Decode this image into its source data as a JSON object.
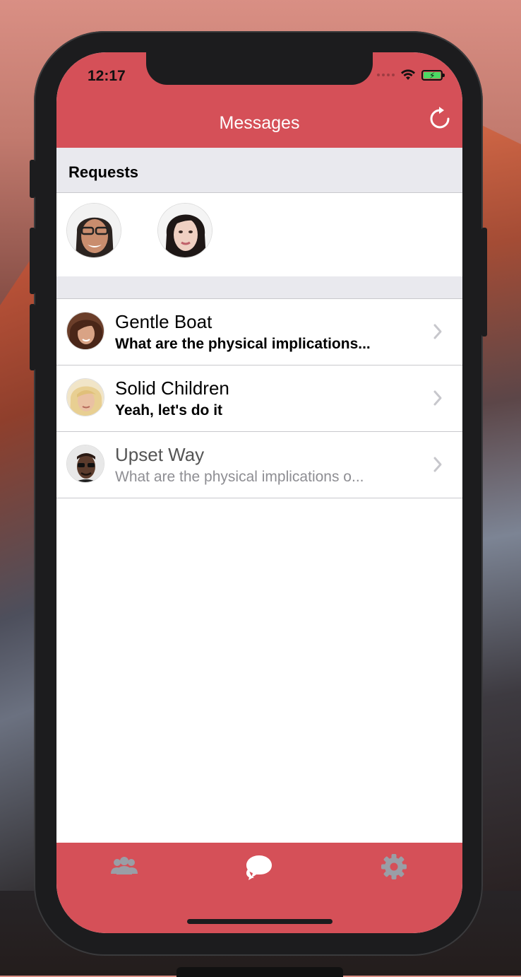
{
  "status_bar": {
    "time": "12:17"
  },
  "nav": {
    "title": "Messages",
    "refresh_icon": "refresh-icon"
  },
  "requests_section": {
    "label": "Requests",
    "avatars": [
      {
        "name": "request-avatar-1"
      },
      {
        "name": "request-avatar-2"
      }
    ]
  },
  "chats": [
    {
      "name": "Gentle Boat",
      "preview": "What are the physical implications...",
      "state": "unread"
    },
    {
      "name": "Solid Children",
      "preview": "Yeah, let's do it",
      "state": "unread"
    },
    {
      "name": "Upset Way",
      "preview": "What are the physical implications o...",
      "state": "read"
    }
  ],
  "tab_bar": {
    "tabs": [
      {
        "icon": "people-icon",
        "active": false
      },
      {
        "icon": "chat-bubbles-icon",
        "active": true
      },
      {
        "icon": "gear-icon",
        "active": false
      }
    ]
  },
  "colors": {
    "accent": "#d55058",
    "section_bg": "#e9e9ee",
    "separator": "#c8c8cc",
    "inactive_tab": "#9a9ea6"
  }
}
